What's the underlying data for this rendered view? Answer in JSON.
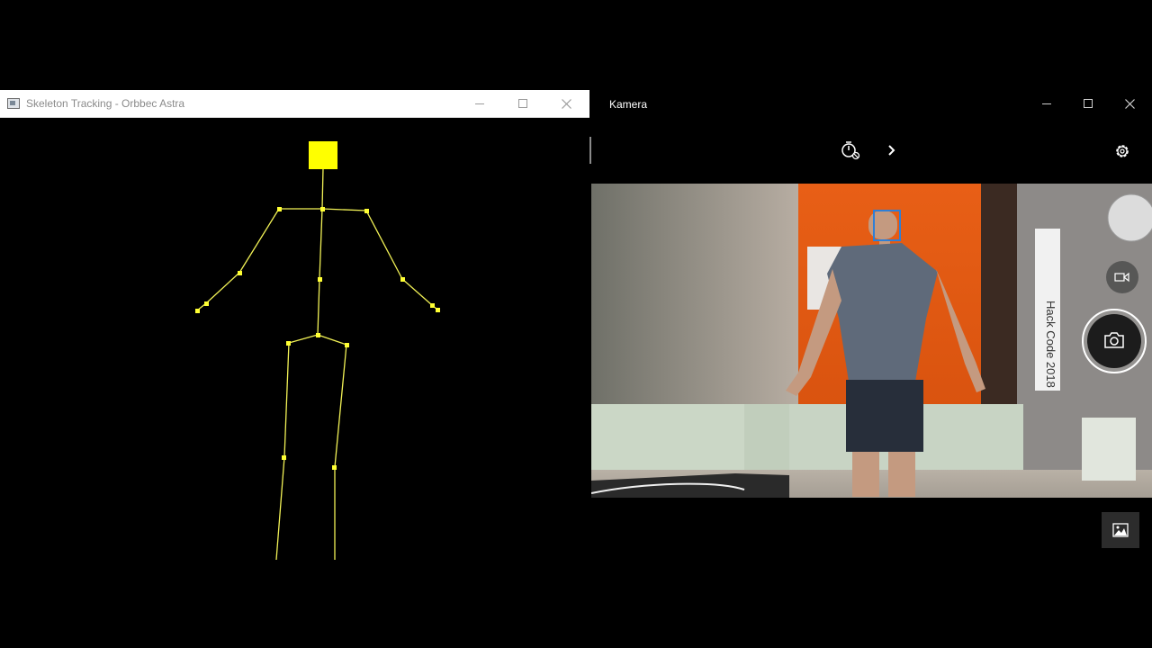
{
  "skeleton_window": {
    "title": "Skeleton Tracking - Orbbec Astra",
    "colors": {
      "bone": "#f2f256",
      "joint": "#ffff33",
      "head": "#ffff00",
      "background": "#000000"
    }
  },
  "camera_window": {
    "title": "Kamera",
    "buttons": {
      "timer": "timer-icon",
      "more": "chevron-right-icon",
      "settings": "gear-icon",
      "video_mode": "video-camera-icon",
      "take_photo": "camera-icon",
      "gallery": "photo-gallery-icon"
    },
    "face_box_color": "#2f7fd6"
  },
  "caption_buttons": {
    "minimize": "minimize-icon",
    "maximize": "maximize-icon",
    "close": "close-icon"
  }
}
